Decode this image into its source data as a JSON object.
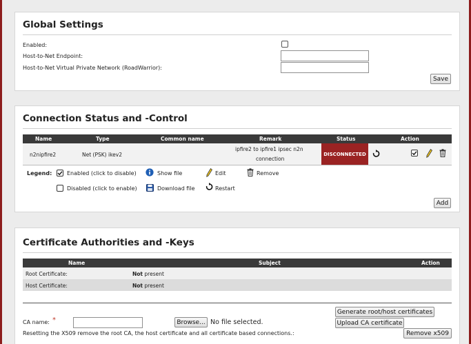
{
  "global": {
    "title": "Global Settings",
    "enabled_label": "Enabled:",
    "endpoint_label": "Host-to-Net Endpoint:",
    "vpn_label": "Host-to-Net Virtual Private Network (RoadWarrior):",
    "endpoint_value": "",
    "vpn_value": "",
    "save_label": "Save"
  },
  "connections": {
    "title": "Connection Status and -Control",
    "headers": {
      "name": "Name",
      "type": "Type",
      "common_name": "Common name",
      "remark": "Remark",
      "status": "Status",
      "action": "Action"
    },
    "rows": [
      {
        "name": "n2nipfire2",
        "type": "Net (PSK) ikev2",
        "common_name": "",
        "remark_line1": "ipfire2 to ipfire1 ipsec n2n",
        "remark_line2": "connection",
        "status": "DISCONNECTED"
      }
    ],
    "legend": {
      "title": "Legend:",
      "enabled": "Enabled (click to disable)",
      "disabled": "Disabled (click to enable)",
      "show_file": "Show file",
      "download_file": "Download file",
      "edit": "Edit",
      "restart": "Restart",
      "remove": "Remove"
    },
    "add_label": "Add"
  },
  "certs": {
    "title": "Certificate Authorities and -Keys",
    "headers": {
      "name": "Name",
      "subject": "Subject",
      "action": "Action"
    },
    "rows": [
      {
        "name": "Root Certificate:",
        "subject_bold": "Not",
        "subject_rest": " present"
      },
      {
        "name": "Host Certificate:",
        "subject_bold": "Not",
        "subject_rest": " present"
      }
    ],
    "generate_label": "Generate root/host certificates",
    "upload_label": "Upload CA certificate",
    "ca_name_label": "CA name:",
    "ca_name_required": "*",
    "ca_name_value": "",
    "browse_label": "Browse...",
    "no_file": "No file selected.",
    "reset_note": "Resetting the X509 remove the root CA, the host certificate and all certificate based connections.:",
    "remove_x509_label": "Remove x509"
  },
  "colors": {
    "accent": "#8c1d1d",
    "status_bg": "#9a2323",
    "header_bg": "#3a3a3a",
    "info_blue": "#1f5fb5"
  }
}
